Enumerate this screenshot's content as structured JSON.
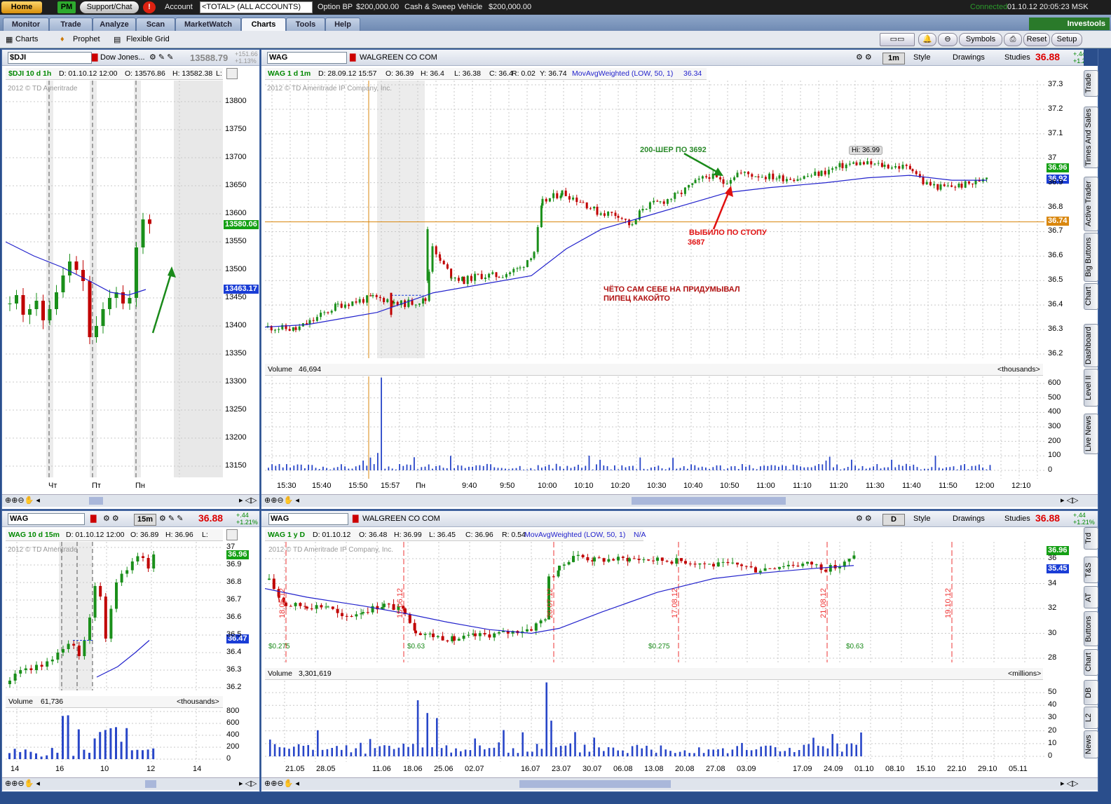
{
  "topbar": {
    "home": "Home",
    "pm": "PM",
    "support": "Support/Chat",
    "account_label": "Account",
    "account_value": "<TOTAL> (ALL ACCOUNTS)",
    "option_bp_label": "Option BP",
    "option_bp_value": "$200,000.00",
    "cash_label": "Cash & Sweep Vehicle",
    "cash_value": "$200,000.00",
    "connected": "Connected",
    "datetime": "01.10.12 20:05:23 MSK"
  },
  "tabs": [
    "Monitor",
    "Trade",
    "Analyze",
    "Scan",
    "MarketWatch",
    "Charts",
    "Tools",
    "Help"
  ],
  "active_tab": "Charts",
  "investools": "Investools",
  "subtabs": [
    "Charts",
    "Prophet",
    "Flexible Grid"
  ],
  "right_buttons": {
    "symbols": "Symbols",
    "reset": "Reset",
    "setup": "Setup"
  },
  "dji": {
    "symbol": "$DJI",
    "name": "Dow Jones...",
    "last": "13588.79",
    "change": "+151.66",
    "change_pct": "+1.13%",
    "info": {
      "title": "$DJI 10 d 1h",
      "d": "D: 01.10.12 12:00",
      "o": "O: 13576.86",
      "h": "H: 13582.38",
      "l": "L:"
    },
    "watermark": "2012 © TD Ameritrade",
    "price_labels": [
      "13800",
      "13750",
      "13700",
      "13650",
      "13600",
      "13550",
      "13500",
      "13450",
      "13400",
      "13350",
      "13300",
      "13250",
      "13200",
      "13150"
    ],
    "tag_green": "13580.06",
    "tag_blue": "13463.17",
    "day_labels": [
      "Чт",
      "Пт",
      "Пн"
    ]
  },
  "wag1m": {
    "symbol": "WAG",
    "name": "WALGREEN CO COM",
    "last": "36.88",
    "change": "+.44",
    "change_pct": "+1.21%",
    "aggregation": "1m",
    "style": "Style",
    "drawings": "Drawings",
    "studies": "Studies",
    "info": {
      "title": "WAG 1 d 1m",
      "d": "D: 28.09.12 15:57",
      "o": "O: 36.39",
      "h": "H: 36.4",
      "l": "L: 36.38",
      "c": "C: 36.4",
      "r": "R: 0.02",
      "y": "Y: 36.74",
      "study": "MovAvgWeighted (LOW, 50, 1)",
      "study_val": "36.34"
    },
    "watermark": "2012 © TD Ameritrade IP Company, Inc.",
    "price_labels": [
      "37.3",
      "37.2",
      "37.1",
      "37",
      "36.9",
      "36.8",
      "36.7",
      "36.6",
      "36.5",
      "36.4",
      "36.3",
      "36.2"
    ],
    "tag_green": "36.96",
    "tag_blue": "36.92",
    "tag_orange": "36.74",
    "hi_label": "Hi: 36.99",
    "volume": {
      "label": "Volume",
      "value": "46,694",
      "units": "<thousands>",
      "ticks": [
        "600",
        "500",
        "400",
        "300",
        "200",
        "100",
        "0"
      ]
    },
    "time_labels": [
      "15:30",
      "15:40",
      "15:50",
      "15:57",
      "Пн",
      "9:40",
      "9:50",
      "10:00",
      "10:10",
      "10:20",
      "10:30",
      "10:40",
      "10:50",
      "11:00",
      "11:10",
      "11:20",
      "11:30",
      "11:40",
      "11:50",
      "12:00",
      "12:10"
    ],
    "annotations": {
      "buy": "200-ШЕР ПО 3692",
      "stop1": "ВЫБИЛО ПО СТОПУ",
      "stop2": "3687",
      "comment1": "ЧЁТО САМ СЕБЕ НА ПРИДУМЫВАЛ",
      "comment2": "ПИПЕЦ КАКОЙТО"
    }
  },
  "wag15m": {
    "symbol": "WAG",
    "last": "36.88",
    "change": "+.44",
    "change_pct": "+1.21%",
    "aggregation": "15m",
    "info": {
      "title": "WAG 10 d 15m",
      "d": "D: 01.10.12 12:00",
      "o": "O: 36.89",
      "h": "H: 36.96",
      "l": "L:"
    },
    "watermark": "2012 © TD Ameritrade",
    "price_labels": [
      "37",
      "36.9",
      "36.8",
      "36.7",
      "36.6",
      "36.5",
      "36.4",
      "36.3",
      "36.2"
    ],
    "tag_green": "36.96",
    "tag_blue": "36.47",
    "volume": {
      "label": "Volume",
      "value": "61,736",
      "units": "<thousands>",
      "ticks": [
        "800",
        "600",
        "400",
        "200",
        "0"
      ]
    },
    "time_labels": [
      "14",
      "16",
      "10",
      "12",
      "14"
    ]
  },
  "wag1y": {
    "symbol": "WAG",
    "name": "WALGREEN CO COM",
    "last": "36.88",
    "change": "+.44",
    "change_pct": "+1.21%",
    "aggregation": "D",
    "style": "Style",
    "drawings": "Drawings",
    "studies": "Studies",
    "info": {
      "title": "WAG 1 y D",
      "d": "D: 01.10.12",
      "o": "O: 36.48",
      "h": "H: 36.99",
      "l": "L: 36.45",
      "c": "C: 36.96",
      "r": "R: 0.54",
      "study": "MovAvgWeighted (LOW, 50, 1)",
      "study_val": "N/A"
    },
    "watermark": "2012 © TD Ameritrade IP Company, Inc.",
    "price_labels": [
      "36",
      "34",
      "32",
      "30",
      "28"
    ],
    "tag_green": "36.96",
    "tag_blue": "35.45",
    "event_dates": [
      "18.05.12",
      "15.06.12",
      "20.07.12",
      "17.08.12",
      "21.08.12",
      "19.10.12"
    ],
    "dividends": [
      "$0.275",
      "$0.63",
      "$0.275",
      "$0.63"
    ],
    "volume": {
      "label": "Volume",
      "value": "3,301,619",
      "units": "<millions>",
      "ticks": [
        "50",
        "40",
        "30",
        "20",
        "10",
        "0"
      ]
    },
    "time_labels": [
      "21.05",
      "28.05",
      "11.06",
      "18.06",
      "25.06",
      "02.07",
      "16.07",
      "23.07",
      "30.07",
      "06.08",
      "13.08",
      "20.08",
      "27.08",
      "03.09",
      "17.09",
      "24.09",
      "01.10",
      "08.10",
      "15.10",
      "22.10",
      "29.10",
      "05.11"
    ]
  },
  "side_buttons": [
    "Trade",
    "Times And Sales",
    "Active Trader",
    "Big Buttons",
    "Chart",
    "Dashboard",
    "Level II",
    "Live News"
  ],
  "side_buttons_lower": [
    "Trd",
    "T&S",
    "AT",
    "Buttons",
    "Chart",
    "DB",
    "L2",
    "News"
  ],
  "colors": {
    "up": "#1a8f1a",
    "down": "#c00000",
    "ma": "#2222cc",
    "green_tag": "#14a014",
    "blue_tag": "#1a3dd6",
    "orange": "#d9870e"
  }
}
